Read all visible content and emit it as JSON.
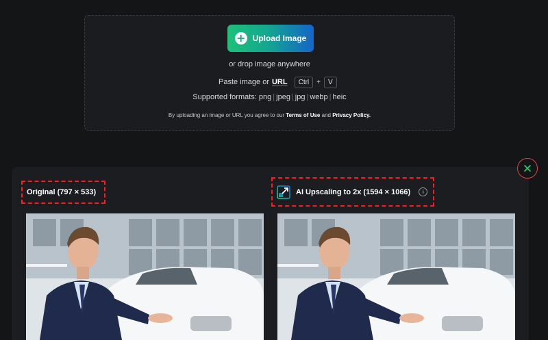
{
  "upload": {
    "button_label": "Upload Image",
    "drop_text": "or drop image anywhere",
    "paste_prefix": "Paste image or",
    "url_label": "URL",
    "key_ctrl": "Ctrl",
    "key_plus": "+",
    "key_v": "V",
    "formats_label": "Supported formats:",
    "formats": [
      "png",
      "jpeg",
      "jpg",
      "webp",
      "heic"
    ],
    "terms_prefix": "By uploading an image or URL you agree to our",
    "terms_link": "Terms of Use",
    "terms_and": "and",
    "privacy_link": "Privacy Policy."
  },
  "results": {
    "original_label": "Original (797 × 533)",
    "upscale_label": "AI Upscaling to 2x (1594 × 1066)",
    "info_glyph": "i",
    "icons": {
      "upload": "plus-circle-icon",
      "close": "close-icon",
      "upscale": "upscale-arrow-icon",
      "info": "info-icon"
    }
  },
  "colors": {
    "accent_green": "#1ec07a",
    "accent_blue": "#1565c8",
    "highlight_red": "#ff1c1c",
    "close_green": "#2ecc71"
  }
}
